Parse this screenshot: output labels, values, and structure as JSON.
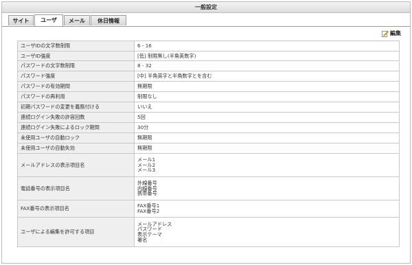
{
  "window": {
    "title": "一般設定"
  },
  "tabs": [
    {
      "label": "サイト",
      "active": false
    },
    {
      "label": "ユーザ",
      "active": true
    },
    {
      "label": "メール",
      "active": false
    },
    {
      "label": "休日情報",
      "active": false
    }
  ],
  "toolbar": {
    "edit_label": "編集",
    "edit_icon": "pencil-icon"
  },
  "settings": [
    {
      "label": "ユーザIDの文字数制限",
      "values": [
        "6 - 16"
      ]
    },
    {
      "label": "ユーザID強度",
      "values": [
        "[低] 制限無し(半角英数字)"
      ]
    },
    {
      "label": "パスワードの文字数制限",
      "values": [
        "8 - 32"
      ]
    },
    {
      "label": "パスワード強度",
      "values": [
        "[中] 半角英字と半角数字とを含む"
      ]
    },
    {
      "label": "パスワードの有効期間",
      "values": [
        "無期限"
      ]
    },
    {
      "label": "パスワードの再利用",
      "values": [
        "制限なし"
      ]
    },
    {
      "label": "初期パスワードの変更を義務付ける",
      "values": [
        "いいえ"
      ]
    },
    {
      "label": "連続ログイン失敗の許容回数",
      "values": [
        "5回"
      ]
    },
    {
      "label": "連続ログイン失敗によるロック期間",
      "values": [
        "30分"
      ]
    },
    {
      "label": "未使用ユーザの自動ロック",
      "values": [
        "無期限"
      ]
    },
    {
      "label": "未使用ユーザの自動失効",
      "values": [
        "無期限"
      ]
    },
    {
      "label": "メールアドレスの表示項目名",
      "values": [
        "メール1",
        "メール2",
        "メール3"
      ]
    },
    {
      "label": "電話番号の表示項目名",
      "values": [
        "外線番号",
        "内線番号",
        "携帯番号"
      ]
    },
    {
      "label": "FAX番号の表示項目名",
      "values": [
        "FAX番号1",
        "FAX番号2"
      ]
    },
    {
      "label": "ユーザによる編集を許可する項目",
      "values": [
        "メールアドレス",
        "パスワード",
        "表示テーマ",
        "署名"
      ]
    }
  ]
}
